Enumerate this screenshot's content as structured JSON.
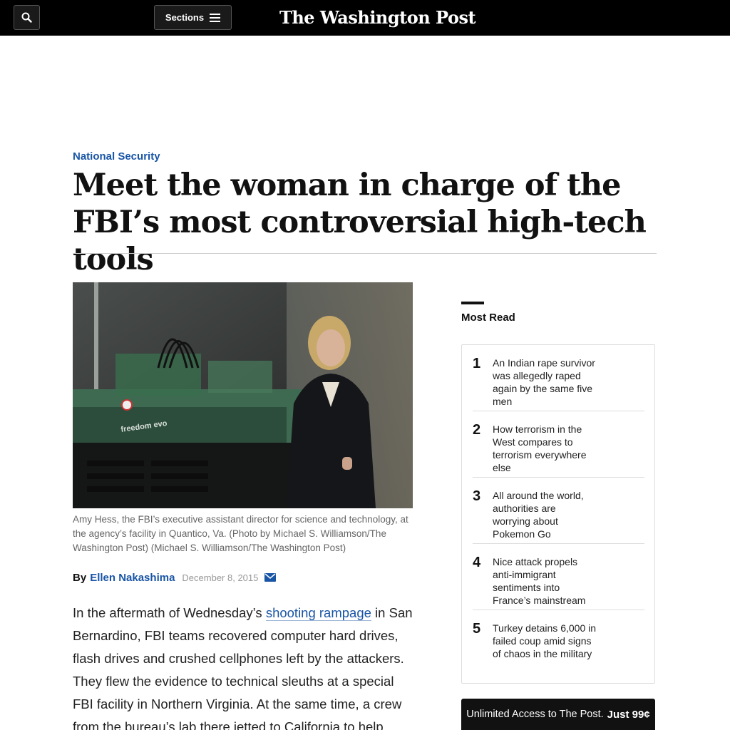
{
  "header": {
    "search_icon": "search-icon",
    "sections_label": "Sections",
    "menu_icon": "hamburger-icon",
    "masthead": "The Washington Post"
  },
  "article": {
    "kicker": "National Security",
    "headline": "Meet the woman in charge of the FBI’s most controversial high-tech tools",
    "caption": "Amy Hess, the FBI’s executive assistant director for science and technology, at the agency’s facility in Quantico, Va. (Photo by Michael S. Williamson/The Washington Post) (Michael S. Williamson/The Washington Post)",
    "byline_prefix": "By",
    "author": "Ellen Nakashima",
    "date": "December 8, 2015",
    "email_icon": "envelope-icon",
    "body_before_link": "In the aftermath of Wednesday’s ",
    "body_link": "shooting rampage",
    "body_after_link": " in San Bernardino, FBI teams recovered computer hard drives, flash drives and crushed cellphones left by the attackers. They flew the evidence to technical sleuths at a special FBI facility in Northern Virginia. At the same time, a crew from the bureau’s lab there jetted to California to help reconstruct"
  },
  "most_read": {
    "title": "Most Read",
    "items": [
      {
        "num": "1",
        "text": "An Indian rape survivor was allegedly raped again by the same five men"
      },
      {
        "num": "2",
        "text": "How terrorism in the West compares to terrorism everywhere else"
      },
      {
        "num": "3",
        "text": "All around the world, authorities are worrying about Pokemon Go"
      },
      {
        "num": "4",
        "text": "Nice attack propels anti-immigrant sentiments into France’s mainstream"
      },
      {
        "num": "5",
        "text": "Turkey detains 6,000 in failed coup amid signs of chaos in the military"
      }
    ]
  },
  "promo": {
    "text": "Unlimited Access to The Post.",
    "price": "Just 99¢"
  }
}
